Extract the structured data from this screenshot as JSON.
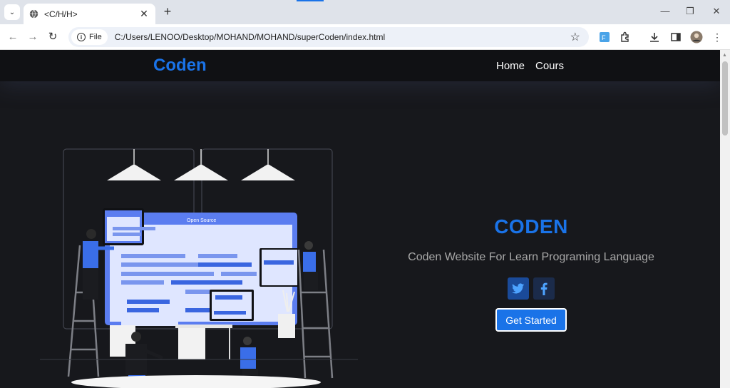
{
  "browser": {
    "tab_title": "<C/H/H>",
    "url_chip": "File",
    "url": "C:/Users/LENOO/Desktop/MOHAND/MOHAND/superCoden/index.html"
  },
  "nav": {
    "brand": "Coden",
    "links": [
      "Home",
      "Cours"
    ]
  },
  "hero": {
    "title": "CODEN",
    "subtitle": "Coden Website For Learn Programing Language",
    "cta": "Get Started",
    "illustration_label": "Open Source"
  },
  "colors": {
    "accent": "#1a73e8",
    "background": "#17181c",
    "twitter_bg": "#1a4a99",
    "facebook_bg": "#1b2b4a"
  },
  "icons": [
    "globe-icon",
    "close-icon",
    "back-icon",
    "forward-icon",
    "reload-icon",
    "info-icon",
    "star-icon",
    "twitter-icon",
    "facebook-icon"
  ]
}
